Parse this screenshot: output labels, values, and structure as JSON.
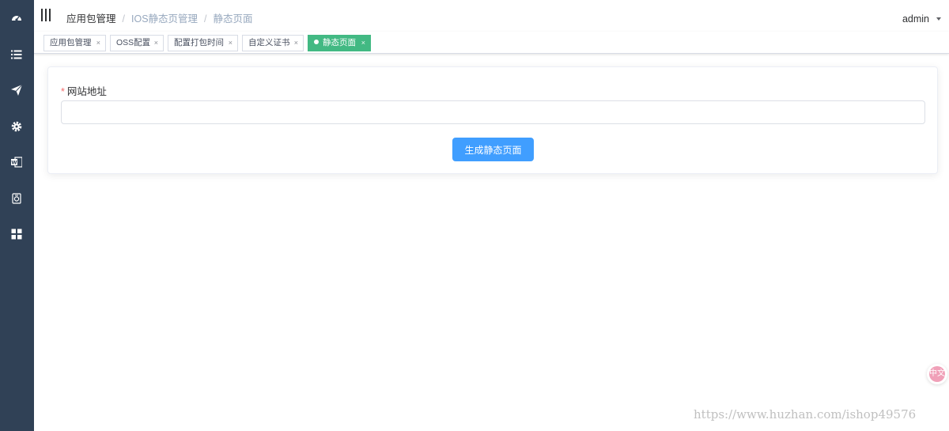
{
  "sidebar": {
    "icons": [
      {
        "name": "dashboard-icon"
      },
      {
        "name": "list-icon"
      },
      {
        "name": "send-icon"
      },
      {
        "name": "gear-icon"
      },
      {
        "name": "word-doc-icon"
      },
      {
        "name": "camera-icon"
      },
      {
        "name": "grid-icon"
      }
    ],
    "background": "#304156"
  },
  "navbar": {
    "breadcrumb": [
      "应用包管理",
      "IOS静态页管理",
      "静态页面"
    ],
    "separator": "/",
    "user": "admin"
  },
  "tags": [
    {
      "label": "应用包管理",
      "active": false
    },
    {
      "label": "OSS配置",
      "active": false
    },
    {
      "label": "配置打包时间",
      "active": false
    },
    {
      "label": "自定义证书",
      "active": false
    },
    {
      "label": "静态页面",
      "active": true
    }
  ],
  "tag_close_glyph": "×",
  "form": {
    "required_mark": "*",
    "url_label": "网站地址",
    "url_value": "",
    "url_placeholder": "",
    "submit_label": "生成静态页面"
  },
  "translate_icon_glyph": "中文",
  "watermark": "https://www.huzhan.com/ishop49576",
  "colors": {
    "primary": "#409eff",
    "active_tag": "#42b983",
    "required": "#f56c6c"
  }
}
